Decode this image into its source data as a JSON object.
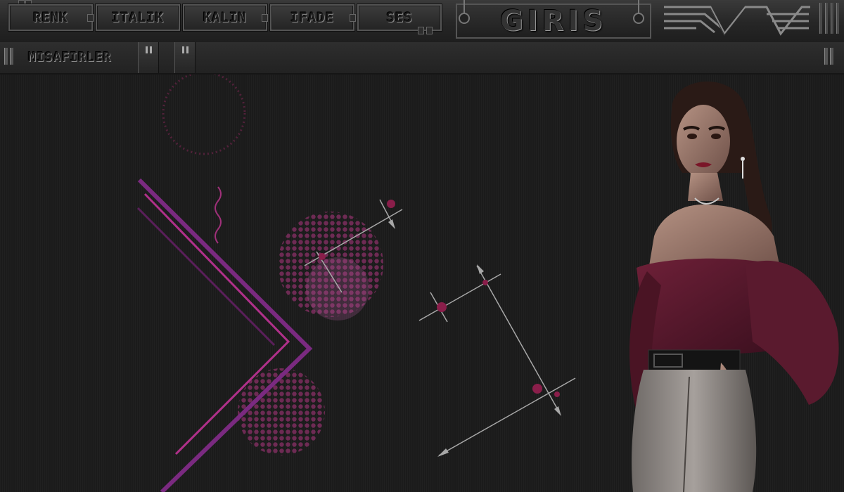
{
  "toolbar": {
    "buttons": [
      {
        "label": "RENK"
      },
      {
        "label": "ITALIK"
      },
      {
        "label": "KALIN"
      },
      {
        "label": "IFADE"
      },
      {
        "label": "SES"
      }
    ],
    "login_label": "GIRIS"
  },
  "guests": {
    "label": "MISAFIRLER"
  },
  "colors": {
    "accent": "#9b2a6a",
    "panel": "#2a2a2a",
    "background": "#1b1b1b"
  }
}
